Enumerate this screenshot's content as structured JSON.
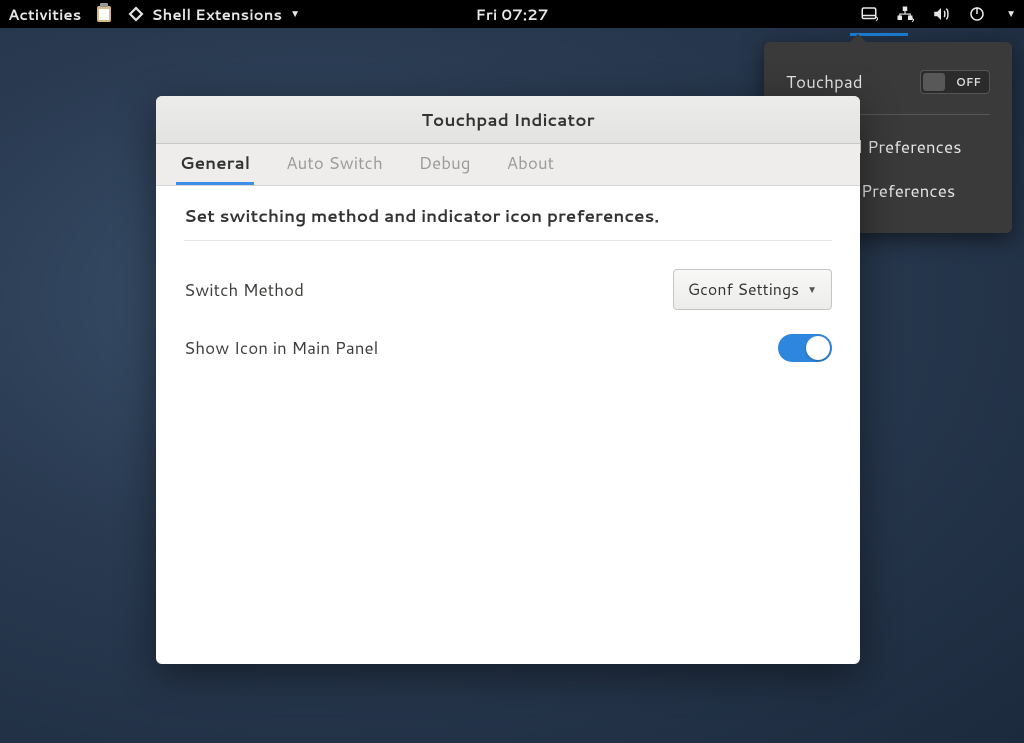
{
  "topbar": {
    "activities": "Activities",
    "app_label": "Shell Extensions",
    "clock": "Fri 07:27"
  },
  "popup": {
    "touchpad_label": "Touchpad",
    "touchpad_state": "OFF",
    "prefs_touchpad": "Touchpad Preferences",
    "prefs_indicator": "Indicator Preferences"
  },
  "dialog": {
    "title": "Touchpad Indicator",
    "tabs": {
      "general": "General",
      "auto_switch": "Auto Switch",
      "debug": "Debug",
      "about": "About"
    },
    "general": {
      "desc": "Set switching method and indicator icon preferences.",
      "switch_method_label": "Switch Method",
      "switch_method_value": "Gconf Settings",
      "show_icon_label": "Show Icon in Main Panel",
      "show_icon_value": true
    }
  }
}
